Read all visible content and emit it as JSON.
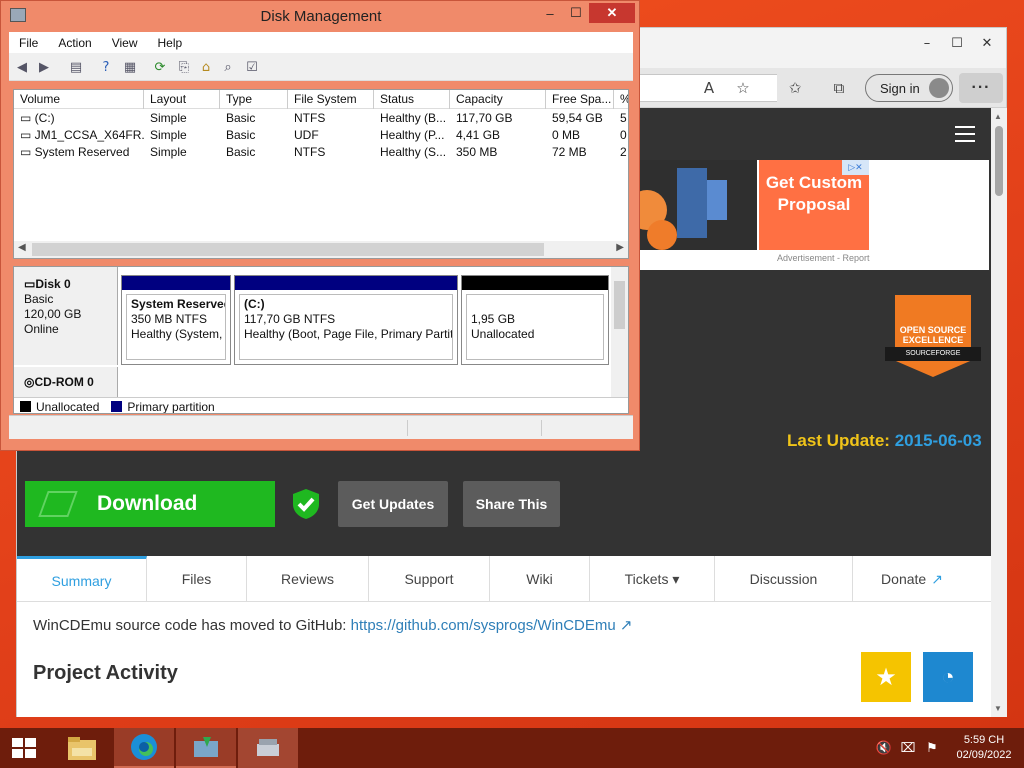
{
  "disk_mgmt": {
    "title": "Disk Management",
    "menu": [
      "File",
      "Action",
      "View",
      "Help"
    ],
    "columns": [
      "Volume",
      "Layout",
      "Type",
      "File System",
      "Status",
      "Capacity",
      "Free Spa...",
      "%"
    ],
    "rows": [
      {
        "volume": "(C:)",
        "layout": "Simple",
        "type": "Basic",
        "fs": "NTFS",
        "status": "Healthy (B...",
        "capacity": "117,70 GB",
        "free": "59,54 GB",
        "pct": "5"
      },
      {
        "volume": "JM1_CCSA_X64FR...",
        "layout": "Simple",
        "type": "Basic",
        "fs": "UDF",
        "status": "Healthy (P...",
        "capacity": "4,41 GB",
        "free": "0 MB",
        "pct": "0"
      },
      {
        "volume": "System Reserved",
        "layout": "Simple",
        "type": "Basic",
        "fs": "NTFS",
        "status": "Healthy (S...",
        "capacity": "350 MB",
        "free": "72 MB",
        "pct": "2"
      }
    ],
    "disk0": {
      "name": "Disk 0",
      "type": "Basic",
      "size": "120,00 GB",
      "state": "Online"
    },
    "partitions": [
      {
        "name": "System Reserved",
        "size": "350 MB NTFS",
        "status": "Healthy (System, A"
      },
      {
        "name": "(C:)",
        "size": "117,70 GB NTFS",
        "status": "Healthy (Boot, Page File, Primary Partitio"
      },
      {
        "name": "",
        "size": "1,95 GB",
        "status": "Unallocated"
      }
    ],
    "cdrom": "CD-ROM 0",
    "legend": {
      "unallocated": "Unallocated",
      "primary": "Primary partition"
    },
    "colors": {
      "primary": "#000080",
      "unallocated": "#000000",
      "title_bg": "#f08a6a"
    }
  },
  "browser": {
    "signin": "Sign in",
    "more": "···",
    "ad": {
      "cta": "Get Custom Proposal",
      "caption": "Advertisement - Report"
    },
    "badge": {
      "title": "OPEN SOURCE EXCELLENCE",
      "brand": "SOURCEFORGE"
    },
    "last_update_label": "Last Update:",
    "last_update_value": "2015-06-03",
    "download": "Download",
    "get_updates": "Get Updates",
    "share_this": "Share This",
    "tabs": [
      "Summary",
      "Files",
      "Reviews",
      "Support",
      "Wiki",
      "Tickets ▾",
      "Discussion",
      "Donate"
    ],
    "notice_text": "WinCDEmu source code has moved to GitHub: ",
    "notice_link": "https://github.com/sysprogs/WinCDEmu",
    "project_activity": "Project Activity"
  },
  "taskbar": {
    "time": "5:59 CH",
    "date": "02/09/2022"
  }
}
